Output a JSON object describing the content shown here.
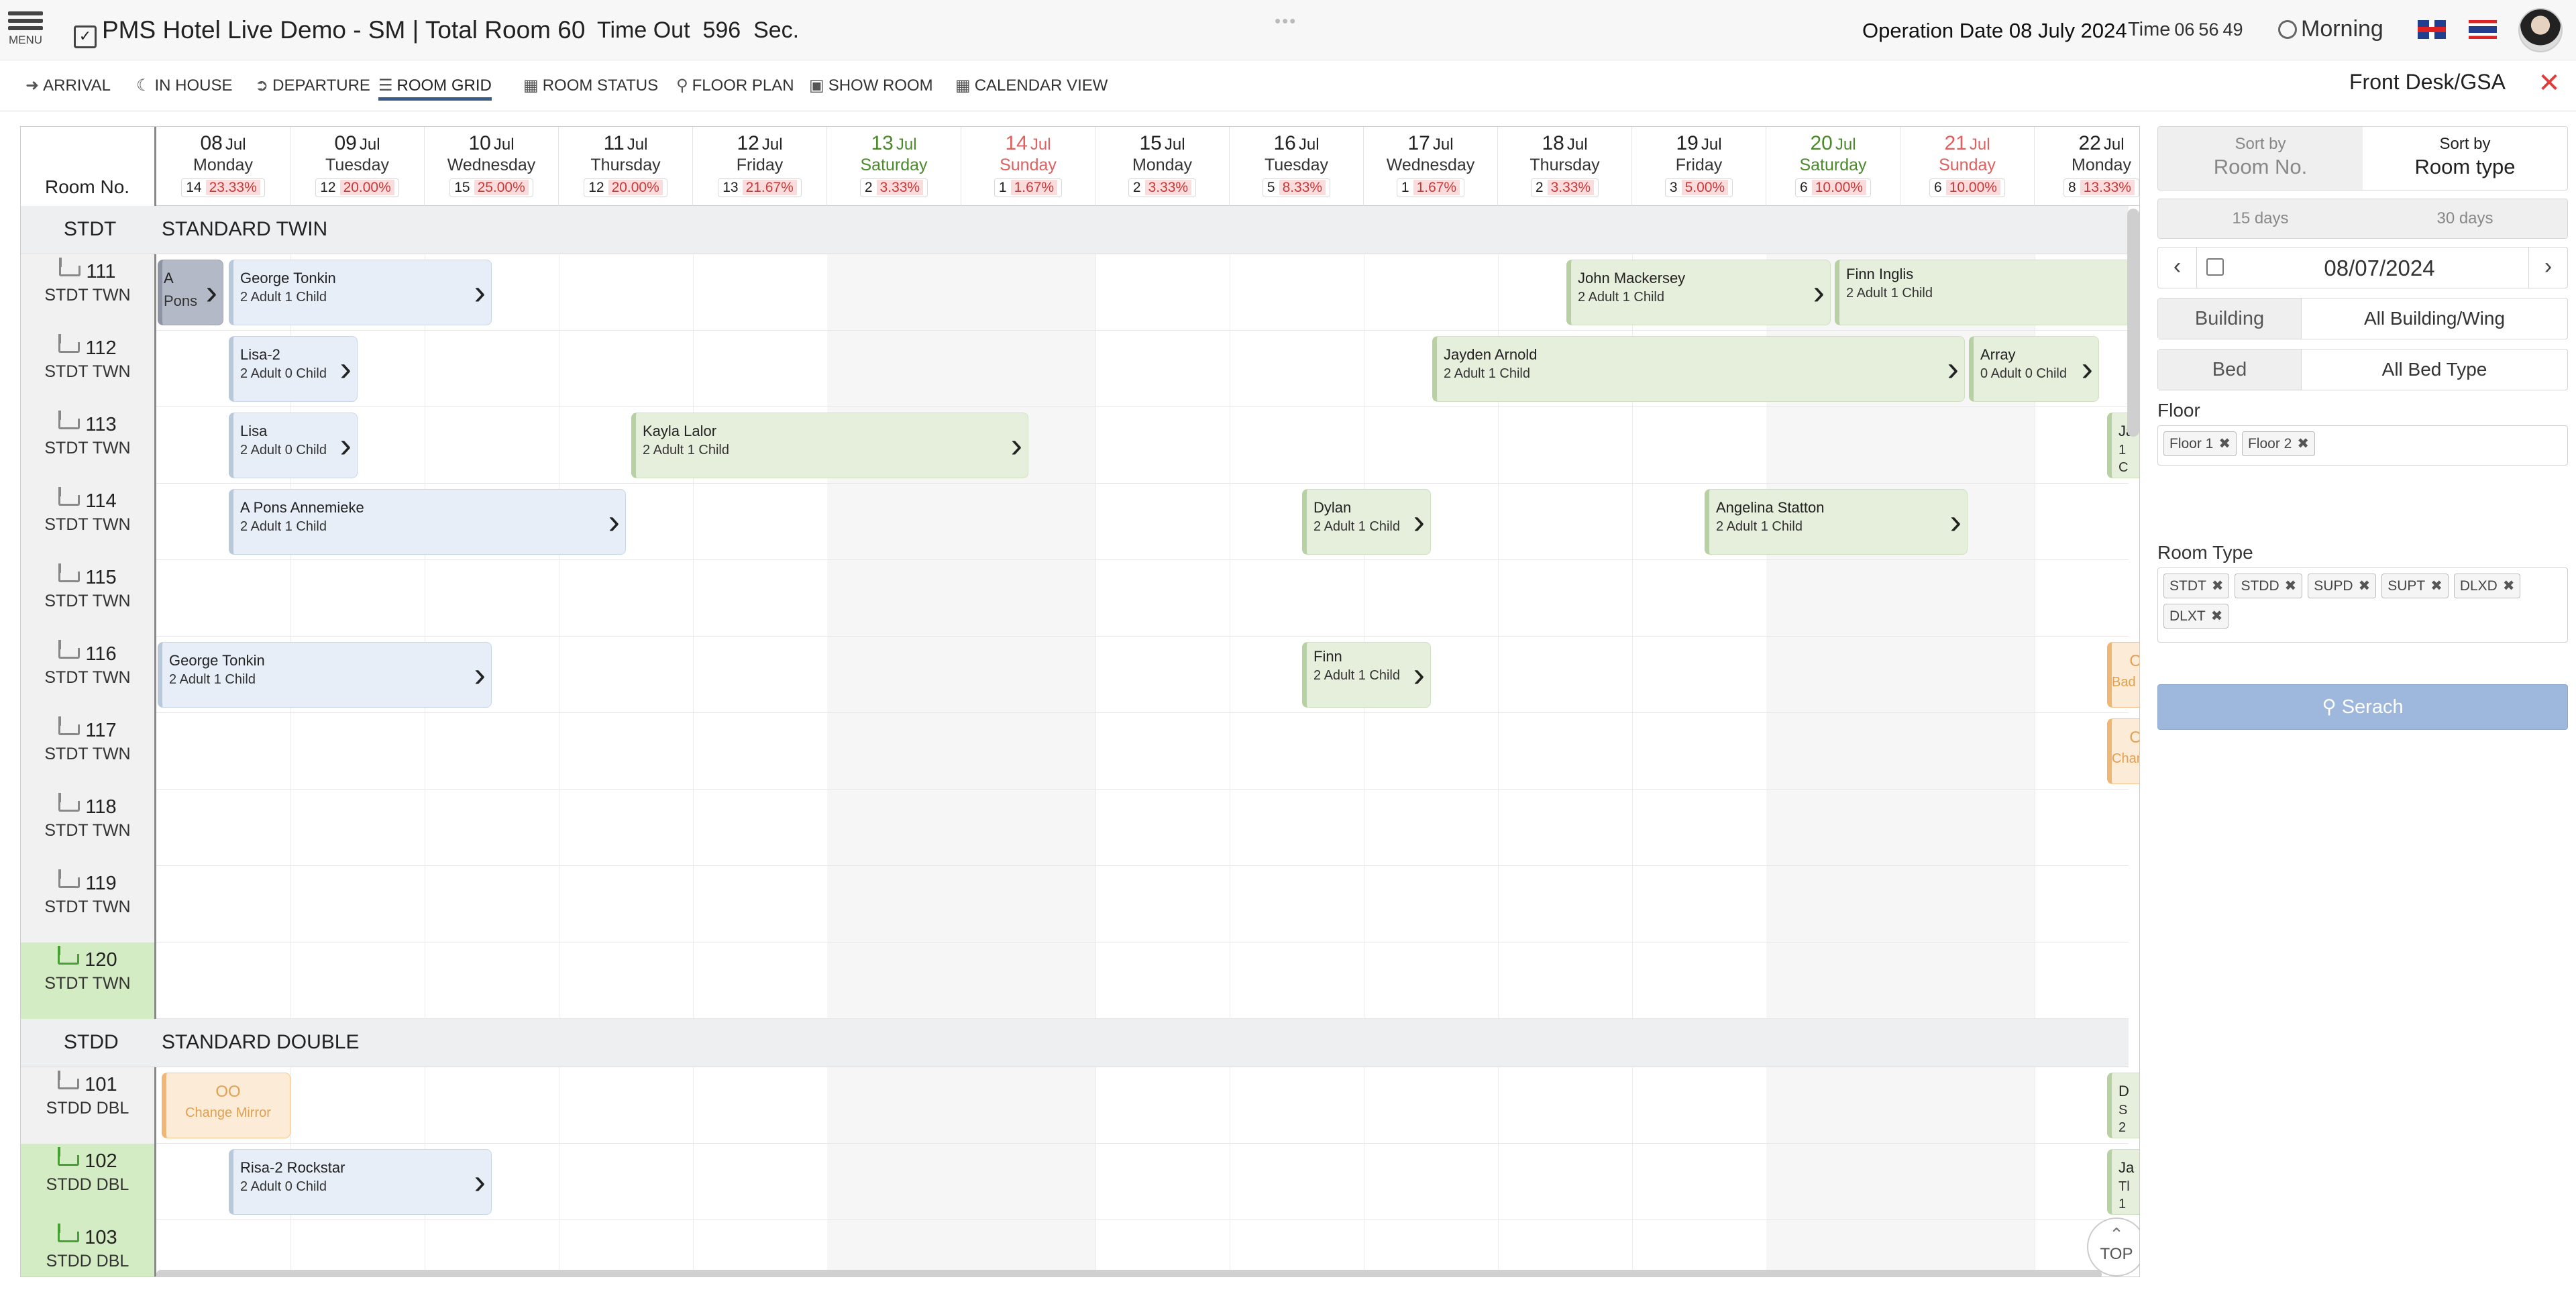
{
  "header": {
    "menu_label": "MENU",
    "title": "PMS Hotel Live Demo - SM | Total Room 60",
    "timeout_label": "Time Out",
    "timeout_value": "596",
    "timeout_unit": "Sec.",
    "operation_date": "Operation Date 08 July 2024",
    "time_label": "Time",
    "time_hh": "06",
    "time_mm": "56",
    "time_ss": "49",
    "shift": "Morning",
    "drag_handle": "•••"
  },
  "nav": {
    "items": [
      {
        "label": "ARRIVAL",
        "icon": "arrival-icon"
      },
      {
        "label": "IN HOUSE",
        "icon": "moon-icon"
      },
      {
        "label": "DEPARTURE",
        "icon": "departure-icon"
      },
      {
        "label": "ROOM GRID",
        "icon": "list-icon"
      },
      {
        "label": "ROOM STATUS",
        "icon": "grid-icon"
      },
      {
        "label": "FLOOR PLAN",
        "icon": "map-pin-icon"
      },
      {
        "label": "SHOW ROOM",
        "icon": "image-icon"
      },
      {
        "label": "CALENDAR VIEW",
        "icon": "calendar-icon"
      }
    ],
    "active": "ROOM GRID",
    "role": "Front Desk/GSA",
    "close_glyph": "✕"
  },
  "grid": {
    "room_no_header": "Room No.",
    "days": [
      {
        "d": "08",
        "m": "Jul",
        "name": "Monday",
        "count": "14",
        "pct": "23.33%",
        "kind": "wd"
      },
      {
        "d": "09",
        "m": "Jul",
        "name": "Tuesday",
        "count": "12",
        "pct": "20.00%",
        "kind": "wd"
      },
      {
        "d": "10",
        "m": "Jul",
        "name": "Wednesday",
        "count": "15",
        "pct": "25.00%",
        "kind": "wd"
      },
      {
        "d": "11",
        "m": "Jul",
        "name": "Thursday",
        "count": "12",
        "pct": "20.00%",
        "kind": "wd"
      },
      {
        "d": "12",
        "m": "Jul",
        "name": "Friday",
        "count": "13",
        "pct": "21.67%",
        "kind": "wd"
      },
      {
        "d": "13",
        "m": "Jul",
        "name": "Saturday",
        "count": "2",
        "pct": "3.33%",
        "kind": "sat"
      },
      {
        "d": "14",
        "m": "Jul",
        "name": "Sunday",
        "count": "1",
        "pct": "1.67%",
        "kind": "sun"
      },
      {
        "d": "15",
        "m": "Jul",
        "name": "Monday",
        "count": "2",
        "pct": "3.33%",
        "kind": "wd"
      },
      {
        "d": "16",
        "m": "Jul",
        "name": "Tuesday",
        "count": "5",
        "pct": "8.33%",
        "kind": "wd"
      },
      {
        "d": "17",
        "m": "Jul",
        "name": "Wednesday",
        "count": "1",
        "pct": "1.67%",
        "kind": "wd"
      },
      {
        "d": "18",
        "m": "Jul",
        "name": "Thursday",
        "count": "2",
        "pct": "3.33%",
        "kind": "wd"
      },
      {
        "d": "19",
        "m": "Jul",
        "name": "Friday",
        "count": "3",
        "pct": "5.00%",
        "kind": "wd"
      },
      {
        "d": "20",
        "m": "Jul",
        "name": "Saturday",
        "count": "6",
        "pct": "10.00%",
        "kind": "sat"
      },
      {
        "d": "21",
        "m": "Jul",
        "name": "Sunday",
        "count": "6",
        "pct": "10.00%",
        "kind": "sun"
      },
      {
        "d": "22",
        "m": "Jul",
        "name": "Monday",
        "count": "8",
        "pct": "13.33%",
        "kind": "wd"
      }
    ],
    "sections": [
      {
        "code": "STDT",
        "name": "STANDARD TWIN",
        "rooms": [
          {
            "no": "111",
            "type": "STDT TWN",
            "clean": false
          },
          {
            "no": "112",
            "type": "STDT TWN",
            "clean": false
          },
          {
            "no": "113",
            "type": "STDT TWN",
            "clean": false
          },
          {
            "no": "114",
            "type": "STDT TWN",
            "clean": false
          },
          {
            "no": "115",
            "type": "STDT TWN",
            "clean": false
          },
          {
            "no": "116",
            "type": "STDT TWN",
            "clean": false
          },
          {
            "no": "117",
            "type": "STDT TWN",
            "clean": false
          },
          {
            "no": "118",
            "type": "STDT TWN",
            "clean": false
          },
          {
            "no": "119",
            "type": "STDT TWN",
            "clean": false
          },
          {
            "no": "120",
            "type": "STDT TWN",
            "clean": true
          }
        ]
      },
      {
        "code": "STDD",
        "name": "STANDARD DOUBLE",
        "rooms": [
          {
            "no": "101",
            "type": "STDD DBL",
            "clean": false
          },
          {
            "no": "102",
            "type": "STDD DBL",
            "clean": true
          },
          {
            "no": "103",
            "type": "STDD DBL",
            "clean": true
          }
        ]
      }
    ],
    "bookings": [
      {
        "s": 0,
        "r": 0,
        "start": 0,
        "len": 0.5,
        "guest": "A",
        "guest2": "Pons",
        "pax": "",
        "style": "gr"
      },
      {
        "s": 0,
        "r": 0,
        "start": 0.53,
        "len": 1.97,
        "guest": "George Tonkin",
        "pax": "2 Adult 1 Child",
        "style": "b"
      },
      {
        "s": 0,
        "r": 0,
        "start": 10.5,
        "len": 1.98,
        "guest": "John Mackersey",
        "pax": "2 Adult 1 Child",
        "style": "g"
      },
      {
        "s": 0,
        "r": 0,
        "start": 12.5,
        "len": 2.55,
        "guest": "Finn Inglis",
        "pax": "2 Adult 1 Child",
        "style": "g",
        "top": true
      },
      {
        "s": 0,
        "r": 1,
        "start": 0.53,
        "len": 0.97,
        "guest": "Lisa-2",
        "pax": "2 Adult 0 Child",
        "style": "b"
      },
      {
        "s": 0,
        "r": 1,
        "start": 9.5,
        "len": 3.98,
        "guest": "Jayden Arnold",
        "pax": "2 Adult 1 Child",
        "style": "g"
      },
      {
        "s": 0,
        "r": 1,
        "start": 13.5,
        "len": 0.98,
        "guest": "Array",
        "pax": "0 Adult 0 Child",
        "style": "g"
      },
      {
        "s": 0,
        "r": 2,
        "start": 0.53,
        "len": 0.97,
        "guest": "Lisa",
        "pax": "2 Adult 0 Child",
        "style": "b"
      },
      {
        "s": 0,
        "r": 2,
        "start": 3.53,
        "len": 2.97,
        "guest": "Kayla Lalor",
        "pax": "2 Adult 1 Child",
        "style": "g"
      },
      {
        "s": 0,
        "r": 2,
        "start": 14.53,
        "len": 0.5,
        "guest": "Ja",
        "pax": "1",
        "pax2": "C",
        "style": "g"
      },
      {
        "s": 0,
        "r": 3,
        "start": 0.53,
        "len": 2.97,
        "guest": "A Pons Annemieke",
        "pax": "2 Adult 1 Child",
        "style": "b"
      },
      {
        "s": 0,
        "r": 3,
        "start": 8.53,
        "len": 0.97,
        "guest": "Dylan",
        "pax": "2 Adult 1 Child",
        "style": "g"
      },
      {
        "s": 0,
        "r": 3,
        "start": 11.53,
        "len": 1.97,
        "guest": "Angelina Statton",
        "pax": "2 Adult 1 Child",
        "style": "g"
      },
      {
        "s": 0,
        "r": 5,
        "start": 0,
        "len": 2.5,
        "guest": "George Tonkin",
        "pax": "2 Adult 1 Child",
        "style": "b"
      },
      {
        "s": 0,
        "r": 5,
        "start": 8.53,
        "len": 0.97,
        "guest": "Finn",
        "pax": "2 Adult 1 Child",
        "style": "g",
        "top": true
      },
      {
        "s": 0,
        "r": 5,
        "start": 14.53,
        "len": 0.5,
        "oo": "OO",
        "reason": "Bad Smell",
        "style": "oo"
      },
      {
        "s": 0,
        "r": 6,
        "start": 14.53,
        "len": 0.5,
        "oo": "OO",
        "reason": "Change Mi",
        "style": "oo"
      },
      {
        "s": 1,
        "r": 0,
        "start": 0.03,
        "len": 0.97,
        "oo": "OO",
        "reason": "Change Mirror",
        "style": "oo"
      },
      {
        "s": 1,
        "r": 0,
        "start": 14.53,
        "len": 0.5,
        "guest": "D",
        "pax": "S",
        "pax2": "2",
        "style": "g"
      },
      {
        "s": 1,
        "r": 1,
        "start": 0.53,
        "len": 1.97,
        "guest": "Risa-2 Rockstar",
        "pax": "2 Adult 0 Child",
        "style": "b"
      },
      {
        "s": 1,
        "r": 1,
        "start": 14.53,
        "len": 0.5,
        "guest": "Ja",
        "pax": "Tl",
        "pax2": "1",
        "style": "g"
      }
    ],
    "top_button": "TOP",
    "top_arrow": "⌃"
  },
  "panel": {
    "sort_by": "Sort by",
    "sort_room_no": "Room No.",
    "sort_room_type": "Room type",
    "days_15": "15 days",
    "days_30": "30 days",
    "date_value": "08/07/2024",
    "prev_glyph": "‹",
    "next_glyph": "›",
    "building_label": "Building",
    "building_value": "All Building/Wing",
    "bed_label": "Bed",
    "bed_value": "All Bed Type",
    "floor_label": "Floor",
    "floors": [
      "Floor 1",
      "Floor 2"
    ],
    "room_type_label": "Room Type",
    "room_types": [
      "STDT",
      "STDD",
      "SUPD",
      "SUPT",
      "DLXD",
      "DLXT"
    ],
    "tag_remove": "✖",
    "search_label": "Serach",
    "search_icon": "search-icon"
  },
  "colors": {
    "accent": "#3a5a8a",
    "close": "#e23b3b",
    "saturday": "#4a8a2a",
    "sunday": "#e06060",
    "booking_blue": "#e7eef8",
    "booking_green": "#e5efdc",
    "out_of_order": "#fcebd6",
    "search_button": "#9db8dc"
  }
}
